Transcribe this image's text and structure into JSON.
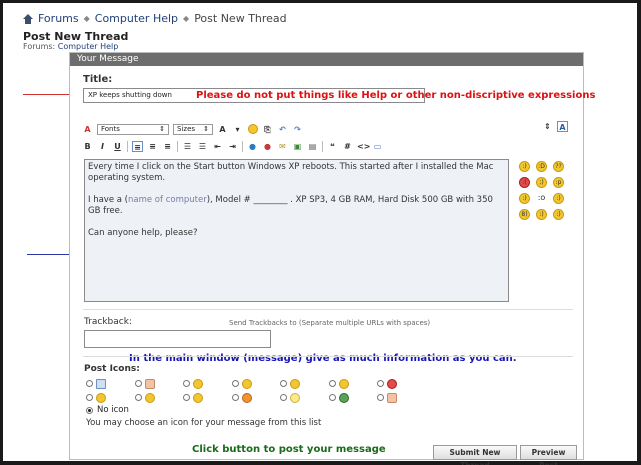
{
  "breadcrumb": {
    "forums": "Forums",
    "section": "Computer Help",
    "current": "Post New Thread"
  },
  "page": {
    "title": "Post New Thread",
    "forums_label": "Forums:",
    "forums_link": "Computer Help"
  },
  "panel": {
    "header": "Your Message"
  },
  "title_field": {
    "label": "Title:",
    "value": "XP keeps shutting down"
  },
  "notes": {
    "red": "Please do not put things like Help or other non-discriptive expressions",
    "blue": "In the main window (message) give as much information as you can.",
    "green": "Click button to post your message"
  },
  "toolbar": {
    "fonts": "Fonts",
    "sizes": "Sizes",
    "bold": "B",
    "italic": "I",
    "underline": "U",
    "code": "#",
    "html": "<>"
  },
  "message": {
    "line1": "Every time I click on the Start button Windows XP reboots.  This started after I installed the Mac operating system.",
    "line2a": "I have a (",
    "line2b": "name of computer",
    "line2c": "), Model # ________ .  XP SP3, 4 GB RAM, Hard Disk 500 GB with 350 GB free.",
    "line3": "Can anyone help, please?"
  },
  "smilies": [
    ":)",
    ":D",
    "??",
    ":(",
    ";)",
    ":p",
    ":)",
    ":o",
    ":)",
    "8)",
    ":)",
    ":)"
  ],
  "trackback": {
    "label": "Trackback:",
    "hint": "Send Trackbacks to (Separate multiple URLs with spaces)"
  },
  "post_icons": {
    "label": "Post Icons:",
    "no_icon": "No icon",
    "hint": "You may choose an icon for your message from this list",
    "selected": "No icon"
  },
  "buttons": {
    "submit": "Submit New Thread",
    "preview": "Preview Post"
  },
  "colors": {
    "red_note": "#dd1111",
    "blue_note": "#1616b8",
    "green_note": "#186b18",
    "panel_header": "#6d6d6d",
    "link": "#22417a"
  }
}
